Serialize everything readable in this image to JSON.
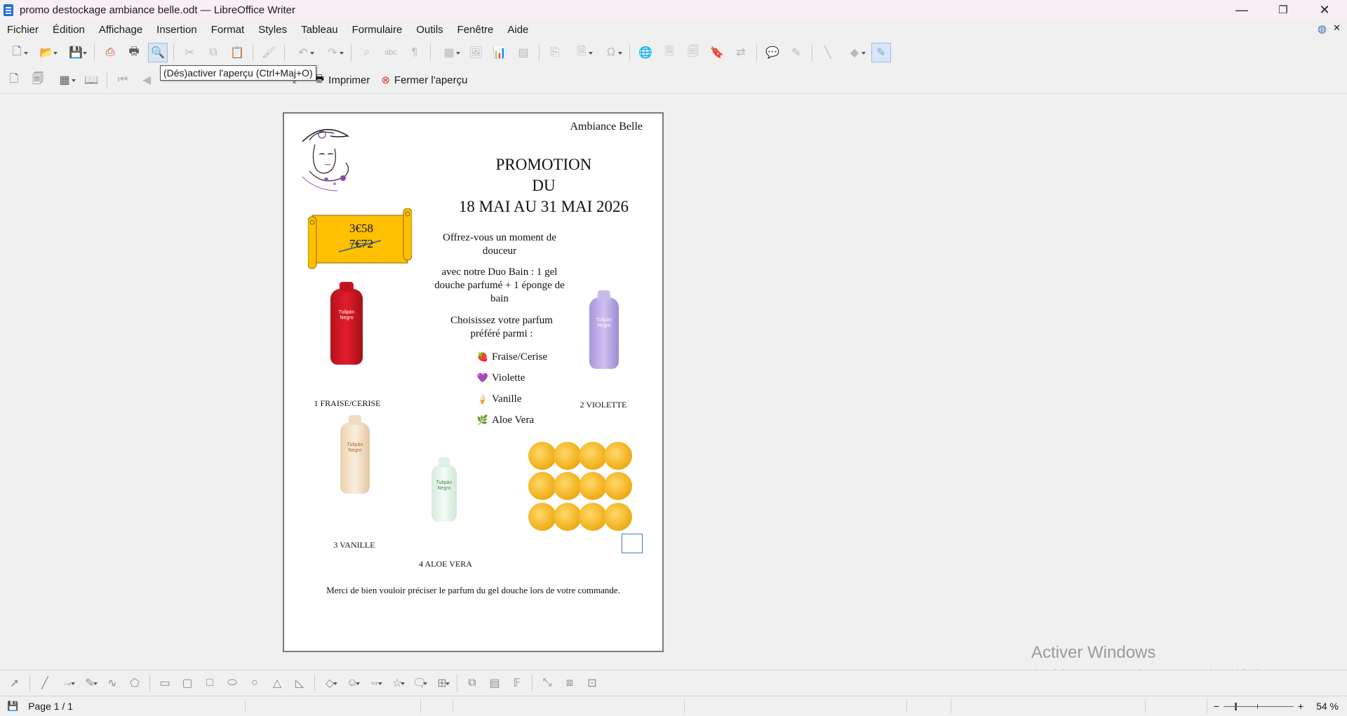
{
  "window": {
    "title": "promo destockage ambiance belle.odt — LibreOffice Writer",
    "minimize_glyph": "—",
    "restore_glyph": "❐",
    "close_glyph": "✕"
  },
  "menu": [
    "Fichier",
    "Édition",
    "Affichage",
    "Insertion",
    "Format",
    "Styles",
    "Tableau",
    "Formulaire",
    "Outils",
    "Fenêtre",
    "Aide"
  ],
  "preview_toolbar": {
    "print_label": "Imprimer",
    "close_preview_label": "Fermer l'aperçu"
  },
  "tooltip": "(Dés)activer l'aperçu (Ctrl+Maj+O)",
  "document": {
    "brand": "Ambiance Belle",
    "promo_line1": "PROMOTION",
    "promo_line2": "DU",
    "promo_line3": "18 MAI AU 31 MAI 2026",
    "price_new": "3€58",
    "price_old": "7€72",
    "intro": "Offrez-vous un moment de douceur",
    "duo": "avec notre Duo Bain : 1 gel douche parfumé + 1 éponge de bain",
    "choose": "Choisissez votre parfum préféré parmi :",
    "scents": [
      {
        "symbol": "🍓",
        "label": "Fraise/Cerise"
      },
      {
        "symbol": "💜",
        "label": "Violette"
      },
      {
        "symbol": "🍦",
        "label": "Vanille"
      },
      {
        "symbol": "🌿",
        "label": "Aloe Vera"
      }
    ],
    "captions": {
      "p1": "1 FRAISE/CERISE",
      "p2": "2 VIOLETTE",
      "p3": "3 VANILLE",
      "p4": "4 ALOE VERA"
    },
    "bottle_brand": "Tulipán Negro",
    "footer": "Merci de bien vouloir préciser le parfum du gel douche lors de votre commande."
  },
  "watermark": {
    "line1": "Activer Windows",
    "line2": "Accédez aux paramètres pour activer Windows."
  },
  "status": {
    "page": "Page 1 / 1",
    "zoom": "54 %"
  },
  "colors": {
    "scroll_fill": "#ffc000",
    "accent_blue": "#1e6fd9",
    "red_bottle": "#e11d2a",
    "violet_bottle": "#b9a7e6",
    "vanilla_bottle": "#f6e2c4",
    "aloe_bottle": "#e6f3ea"
  }
}
